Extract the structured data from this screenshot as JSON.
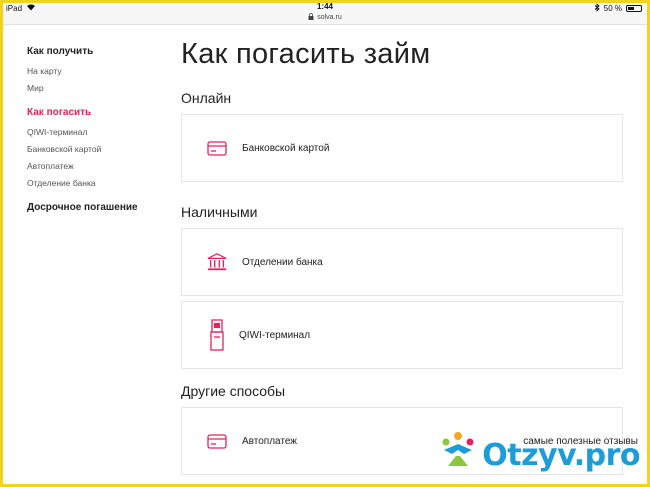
{
  "status_bar": {
    "device": "iPad",
    "time": "1:44",
    "url": "solva.ru",
    "battery": "50 %"
  },
  "sidebar": {
    "groups": [
      {
        "heading": "Как получить",
        "active": false,
        "items": [
          "На карту",
          "Мир"
        ]
      },
      {
        "heading": "Как погасить",
        "active": true,
        "items": [
          "QIWI-терминал",
          "Банковской картой",
          "Автоплатеж",
          "Отделение банка"
        ]
      },
      {
        "heading": "Досрочное погашение",
        "active": false,
        "items": []
      }
    ]
  },
  "main": {
    "title": "Как погасить займ",
    "sections": [
      {
        "title": "Онлайн",
        "cards": [
          {
            "label": "Банковской картой",
            "icon": "credit-card-icon"
          }
        ]
      },
      {
        "title": "Наличными",
        "cards": [
          {
            "label": "Отделении банка",
            "icon": "bank-building-icon"
          },
          {
            "label": "QIWI-терминал",
            "icon": "payment-terminal-icon"
          }
        ]
      },
      {
        "title": "Другие способы",
        "cards": [
          {
            "label": "Автоплатеж",
            "icon": "credit-card-icon"
          }
        ]
      }
    ]
  },
  "watermark": {
    "caption": "самые полезные отзывы",
    "brand": "Otzyv.pro"
  },
  "colors": {
    "accent": "#e8215a",
    "frame": "#f2d21b",
    "brand_blue": "#1d9cd8"
  }
}
